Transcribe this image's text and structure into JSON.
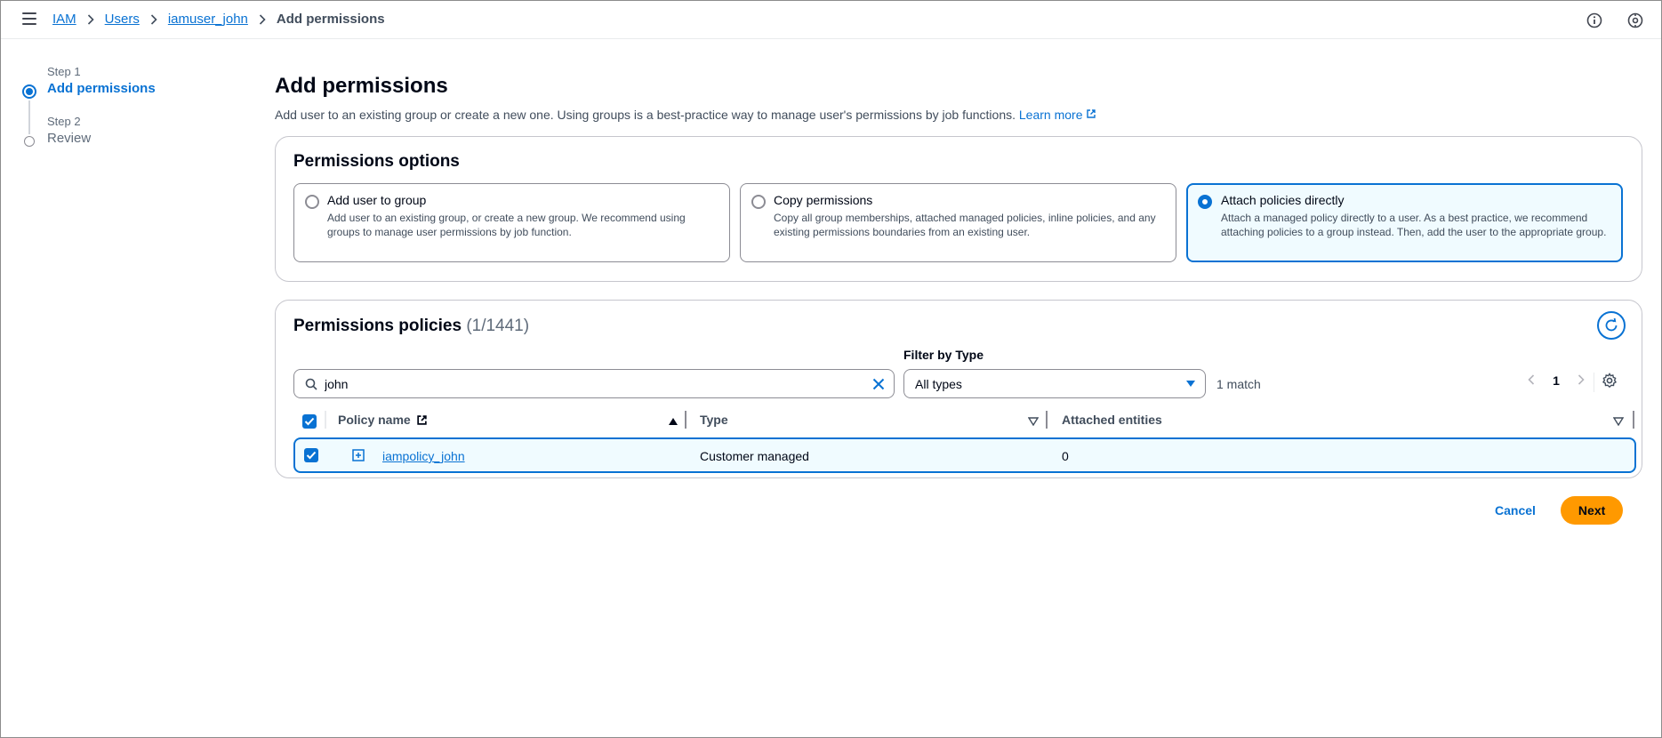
{
  "breadcrumb": {
    "items": [
      "IAM",
      "Users",
      "iamuser_john"
    ],
    "current": "Add permissions"
  },
  "topbar": {
    "icons": [
      "info-icon",
      "settings-circle-icon"
    ]
  },
  "wizard": {
    "steps": [
      {
        "label": "Step 1",
        "title": "Add permissions",
        "state": "active"
      },
      {
        "label": "Step 2",
        "title": "Review",
        "state": "inactive"
      }
    ]
  },
  "header": {
    "title": "Add permissions",
    "description": "Add user to an existing group or create a new one. Using groups is a best-practice way to manage user's permissions by job functions.",
    "learn_more": "Learn more"
  },
  "options": {
    "title": "Permissions options",
    "cards": [
      {
        "title": "Add user to group",
        "desc": "Add user to an existing group, or create a new group. We recommend using groups to manage user permissions by job function.",
        "selected": false
      },
      {
        "title": "Copy permissions",
        "desc": "Copy all group memberships, attached managed policies, inline policies, and any existing permissions boundaries from an existing user.",
        "selected": false
      },
      {
        "title": "Attach policies directly",
        "desc": "Attach a managed policy directly to a user. As a best practice, we recommend attaching policies to a group instead. Then, add the user to the appropriate group.",
        "selected": true
      }
    ]
  },
  "policies": {
    "title": "Permissions policies",
    "count": "(1/1441)",
    "filter_label": "Filter by Type",
    "search_value": "john",
    "filter_value": "All types",
    "match_count": "1 match",
    "page": "1",
    "columns": [
      "Policy name",
      "Type",
      "Attached entities"
    ],
    "rows": [
      {
        "name": "iampolicy_john",
        "type": "Customer managed",
        "attached": "0",
        "checked": true
      }
    ]
  },
  "actions": {
    "cancel": "Cancel",
    "next": "Next"
  },
  "colors": {
    "link": "#0972d3",
    "primary_button": "#ff9900",
    "selected_bg": "#f0fbff"
  }
}
